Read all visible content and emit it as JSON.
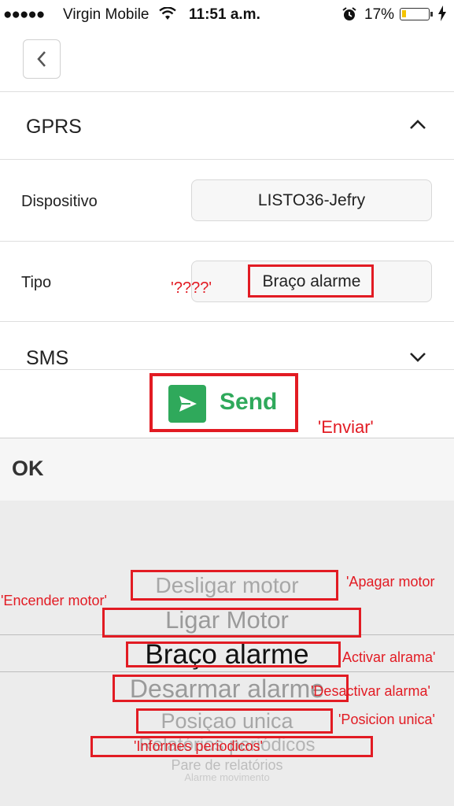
{
  "status_bar": {
    "signal": "●●●●●",
    "carrier": "Virgin Mobile",
    "time": "11:51 a.m.",
    "battery_percent": "17%",
    "battery_level": 0.17
  },
  "sections": {
    "gprs": "GPRS",
    "sms": "SMS"
  },
  "form": {
    "device_label": "Dispositivo",
    "device_value": "LISTO36-Jefry",
    "type_label": "Tipo",
    "type_value": "Braço alarme"
  },
  "send_label": "Send",
  "ok_label": "OK",
  "picker": {
    "options": [
      "Desligar motor",
      "Ligar Motor",
      "Braço alarme",
      "Desarmar alarme",
      "Posiçao unica",
      "Relatórios periódicos",
      "Pare de relatórios",
      "Alarme movimento"
    ],
    "selected": "Braço alarme"
  },
  "annotations": {
    "tipo": "'????'",
    "send": "'Enviar'",
    "desligar": "'Apagar motor",
    "ligar": "'Encender motor'",
    "braco": "Activar alrama'",
    "desarmar": "'Desactivar alarma'",
    "posicao": "'Posicion unica'",
    "relatorios": "'Informes periodicos'"
  },
  "colors": {
    "accent_green": "#2fa95b",
    "annotation_red": "#e21b23"
  }
}
